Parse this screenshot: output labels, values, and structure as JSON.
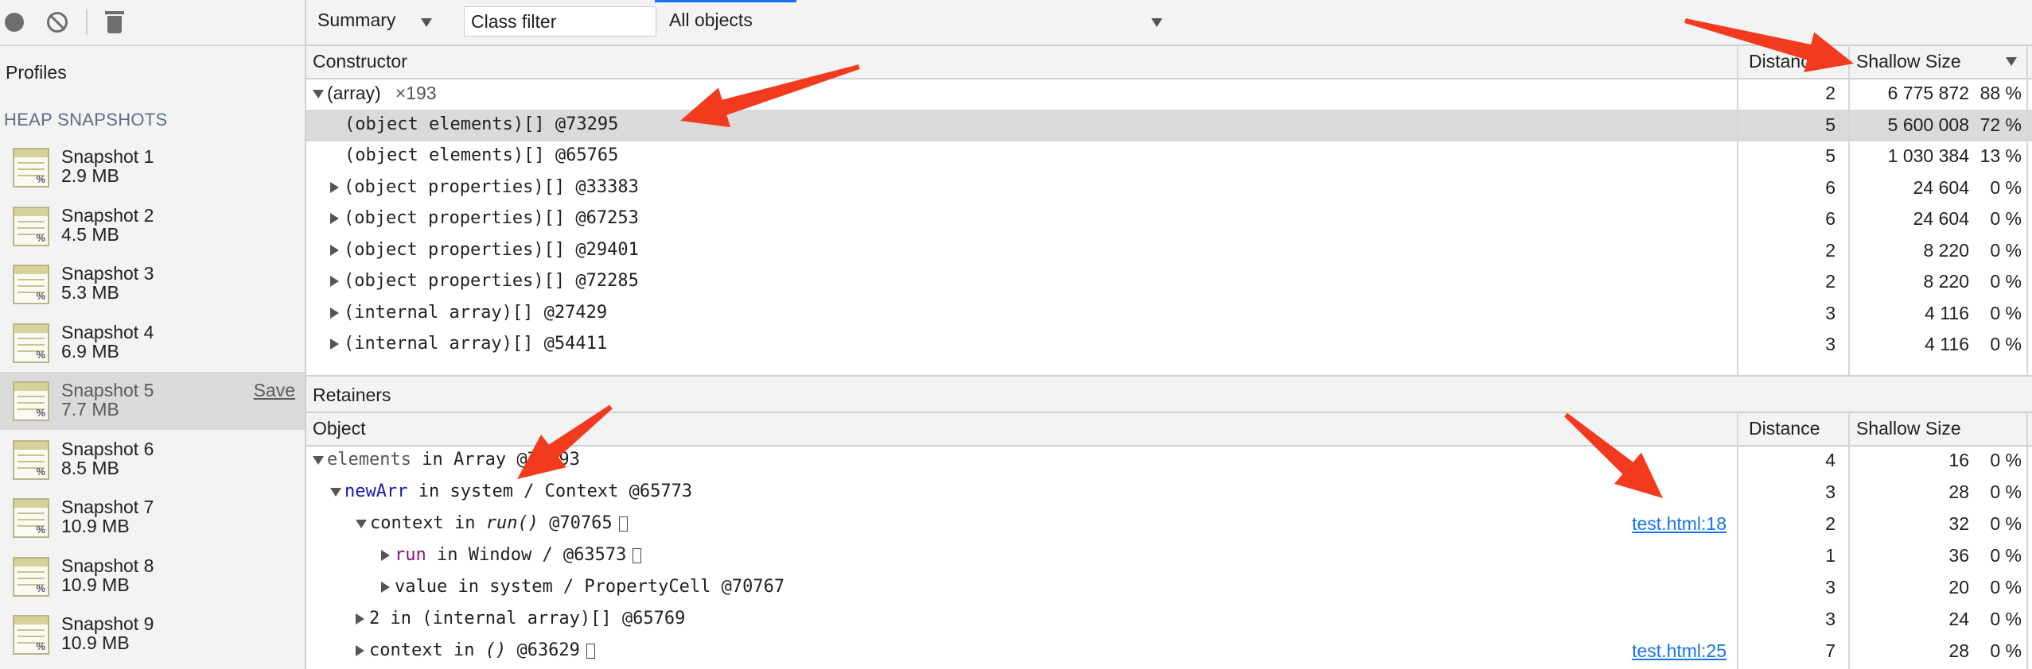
{
  "sidebar": {
    "profiles_title": "Profiles",
    "heap_title": "HEAP SNAPSHOTS",
    "snapshots": [
      {
        "name": "Snapshot 1",
        "size": "2.9 MB"
      },
      {
        "name": "Snapshot 2",
        "size": "4.5 MB"
      },
      {
        "name": "Snapshot 3",
        "size": "5.3 MB"
      },
      {
        "name": "Snapshot 4",
        "size": "6.9 MB"
      },
      {
        "name": "Snapshot 5",
        "size": "7.7 MB",
        "selected": true,
        "action": "Save"
      },
      {
        "name": "Snapshot 6",
        "size": "8.5 MB"
      },
      {
        "name": "Snapshot 7",
        "size": "10.9 MB"
      },
      {
        "name": "Snapshot 8",
        "size": "10.9 MB"
      },
      {
        "name": "Snapshot 9",
        "size": "10.9 MB"
      }
    ]
  },
  "toolbar": {
    "view": "Summary",
    "class_filter_placeholder": "Class filter",
    "objects": "All objects"
  },
  "constructors": {
    "headers": {
      "constructor": "Constructor",
      "distance": "Distance",
      "shallow": "Shallow Size"
    },
    "rows": [
      {
        "label": "(array)",
        "count": "×193",
        "distance": "2",
        "size": "6 775 872",
        "pct": "88 %"
      },
      {
        "label": "(object elements)[] @73295",
        "distance": "5",
        "size": "5 600 008",
        "pct": "72 %"
      },
      {
        "label": "(object elements)[] @65765",
        "distance": "5",
        "size": "1 030 384",
        "pct": "13 %"
      },
      {
        "label": "(object properties)[] @33383",
        "distance": "6",
        "size": "24 604",
        "pct": "0 %"
      },
      {
        "label": "(object properties)[] @67253",
        "distance": "6",
        "size": "24 604",
        "pct": "0 %"
      },
      {
        "label": "(object properties)[] @29401",
        "distance": "2",
        "size": "8 220",
        "pct": "0 %"
      },
      {
        "label": "(object properties)[] @72285",
        "distance": "2",
        "size": "8 220",
        "pct": "0 %"
      },
      {
        "label": "(internal array)[] @27429",
        "distance": "3",
        "size": "4 116",
        "pct": "0 %"
      },
      {
        "label": "(internal array)[] @54411",
        "distance": "3",
        "size": "4 116",
        "pct": "0 %"
      }
    ]
  },
  "retainers": {
    "title": "Retainers",
    "headers": {
      "object": "Object",
      "distance": "Distance",
      "shallow": "Shallow Size"
    },
    "rows": [
      {
        "p1": "elements",
        "p2": " in Array @73293",
        "distance": "4",
        "size": "16",
        "pct": "0 %"
      },
      {
        "p1": "newArr",
        "p2": " in system / Context @65773",
        "distance": "3",
        "size": "28",
        "pct": "0 %"
      },
      {
        "p1": "context",
        "p2": " in ",
        "p3": "run()",
        "p4": " @70765",
        "link": "test.html:18",
        "distance": "2",
        "size": "32",
        "pct": "0 %"
      },
      {
        "p1": "run",
        "p2": " in Window /  @63573",
        "distance": "1",
        "size": "36",
        "pct": "0 %"
      },
      {
        "p1": "value",
        "p2": " in system / PropertyCell @70767",
        "distance": "3",
        "size": "20",
        "pct": "0 %"
      },
      {
        "p1": "2",
        "p2": " in (internal array)[] @65769",
        "distance": "3",
        "size": "24",
        "pct": "0 %"
      },
      {
        "p1": "context",
        "p2": " in ",
        "p3": "()",
        "p4": " @63629",
        "link": "test.html:25",
        "distance": "7",
        "size": "28",
        "pct": "0 %"
      }
    ]
  },
  "colors": {
    "annotation_arrow": "#f23a1f",
    "link": "#1a73e8",
    "selected_row": "#dadada"
  }
}
